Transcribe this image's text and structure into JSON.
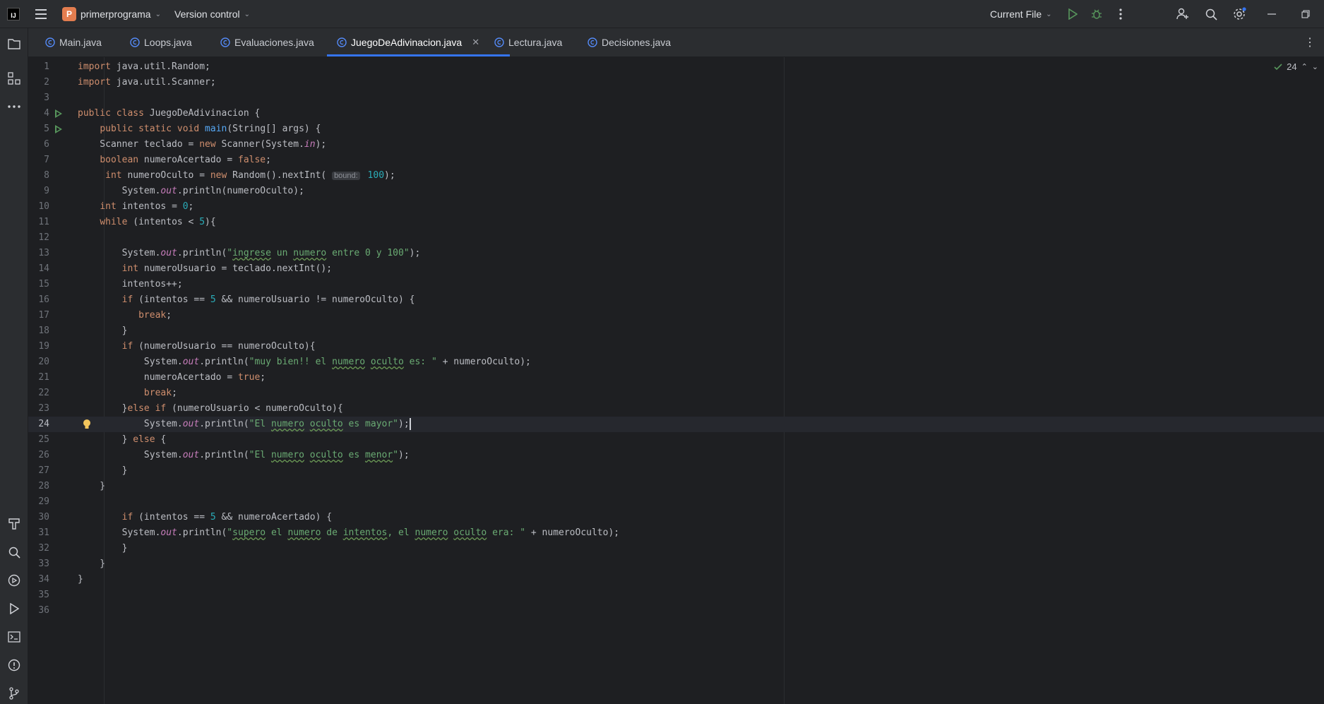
{
  "app": {
    "logo_text": "IJ",
    "project_initial": "P",
    "project_name": "primerprograma",
    "version_control": "Version control",
    "run_config": "Current File"
  },
  "tabs": [
    {
      "label": "Main.java",
      "active": false
    },
    {
      "label": "Loops.java",
      "active": false
    },
    {
      "label": "Evaluaciones.java",
      "active": false
    },
    {
      "label": "JuegoDeAdivinacion.java",
      "active": true
    },
    {
      "label": "Lectura.java",
      "active": false
    },
    {
      "label": "Decisiones.java",
      "active": false
    }
  ],
  "editor": {
    "inspection_count": "24",
    "current_line": 24,
    "hint_label": "bound:",
    "line_numbers": [
      "1",
      "2",
      "3",
      "4",
      "5",
      "6",
      "7",
      "8",
      "9",
      "10",
      "11",
      "12",
      "13",
      "14",
      "15",
      "16",
      "17",
      "18",
      "19",
      "20",
      "21",
      "22",
      "23",
      "24",
      "25",
      "26",
      "27",
      "28",
      "29",
      "30",
      "31",
      "32",
      "33",
      "34",
      "35",
      "36"
    ],
    "lines": [
      "import java.util.Random;",
      "import java.util.Scanner;",
      "",
      "public class JuegoDeAdivinacion {",
      "    public static void main(String[] args) {",
      "    Scanner teclado = new Scanner(System.in);",
      "    boolean numeroAcertado = false;",
      "     int numeroOculto = new Random().nextInt( bound: 100);",
      "        System.out.println(numeroOculto);",
      "    int intentos = 0;",
      "    while (intentos < 5){",
      "",
      "        System.out.println(\"ingrese un numero entre 0 y 100\");",
      "        int numeroUsuario = teclado.nextInt();",
      "        intentos++;",
      "        if (intentos == 5 && numeroUsuario != numeroOculto) {",
      "           break;",
      "        }",
      "        if (numeroUsuario == numeroOculto){",
      "            System.out.println(\"muy bien!! el numero oculto es: \" + numeroOculto);",
      "            numeroAcertado = true;",
      "            break;",
      "        }else if (numeroUsuario < numeroOculto){",
      "            System.out.println(\"El numero oculto es mayor\");",
      "        } else {",
      "            System.out.println(\"El numero oculto es menor\");",
      "        }",
      "    }",
      "",
      "        if (intentos == 5 && numeroAcertado) {",
      "        System.out.println(\"supero el numero de intentos, el numero oculto era: \" + numeroOculto);",
      "        }",
      "    }",
      "}",
      "",
      ""
    ]
  },
  "colors": {
    "accent": "#3574f0",
    "keyword": "#cf8e6d",
    "string": "#6aab73",
    "number": "#2aacb8",
    "static_field": "#c77dbb",
    "method_decl": "#56a8f5",
    "run_icon": "#57965c"
  },
  "icons": {
    "titlebar": [
      "hamburger-icon",
      "run-icon",
      "debug-icon",
      "more-icon",
      "add-user-icon",
      "search-icon",
      "settings-icon",
      "minimize-icon",
      "restore-icon"
    ],
    "toolstrip": [
      "project-folder-icon",
      "structure-icon",
      "more-tools-icon",
      "build-icon",
      "find-icon",
      "services-icon",
      "run-tool-icon",
      "terminal-icon",
      "problems-icon",
      "git-icon"
    ]
  }
}
